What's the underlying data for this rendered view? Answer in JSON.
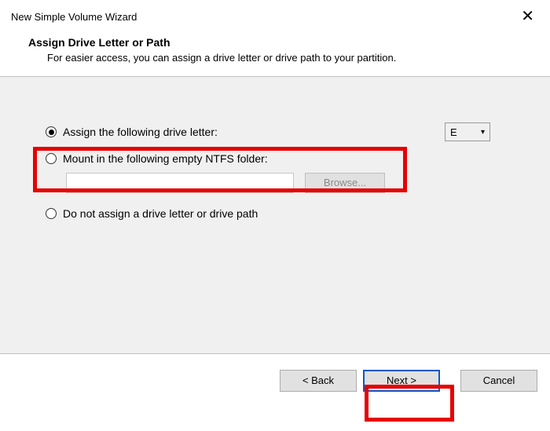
{
  "window": {
    "title": "New Simple Volume Wizard"
  },
  "header": {
    "title": "Assign Drive Letter or Path",
    "subtitle": "For easier access, you can assign a drive letter or drive path to your partition."
  },
  "options": {
    "assign_letter_label": "Assign the following drive letter:",
    "assign_letter_selected": "E",
    "mount_folder_label": "Mount in the following empty NTFS folder:",
    "browse_label": "Browse...",
    "no_assign_label": "Do not assign a drive letter or drive path"
  },
  "footer": {
    "back": "< Back",
    "next": "Next >",
    "cancel": "Cancel"
  }
}
